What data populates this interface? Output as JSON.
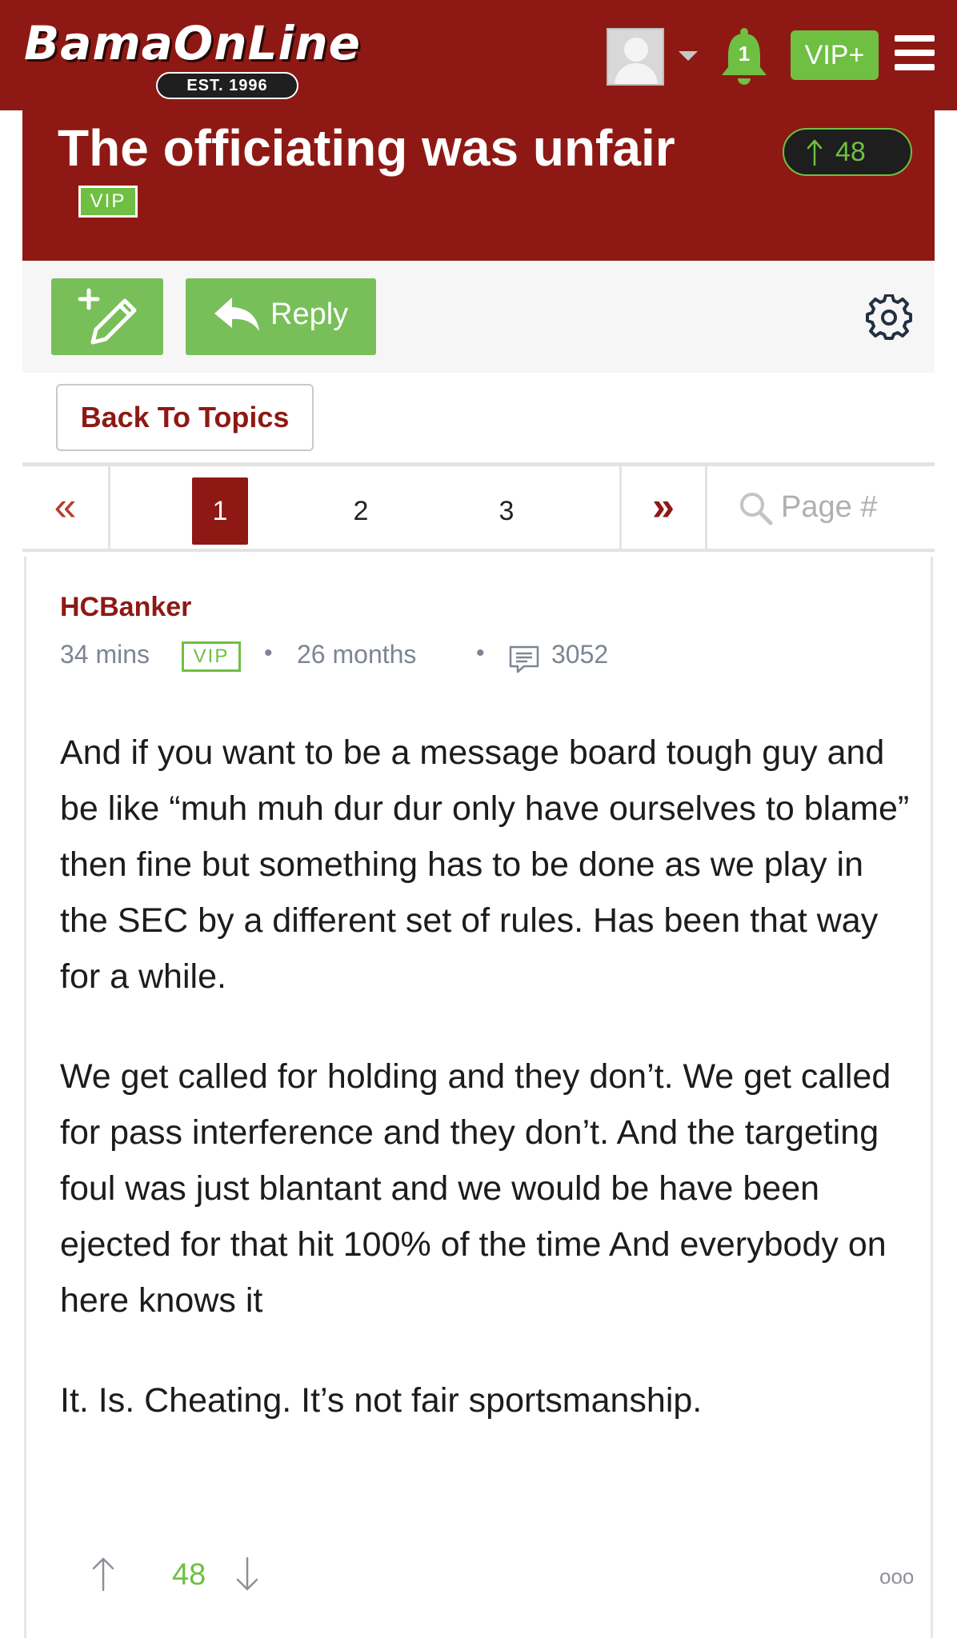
{
  "header": {
    "logo_text": "BamaOnLine",
    "logo_est": "EST. 1996",
    "notification_count": "1",
    "vip_button_label": "VIP+"
  },
  "topic": {
    "title": "The officiating was unfair",
    "badge": "VIP",
    "vote_count": "48"
  },
  "toolbar": {
    "reply_label": "Reply"
  },
  "back_label": "Back To Topics",
  "pagination": {
    "first_glyph": "«",
    "last_glyph": "»",
    "pages": [
      "1",
      "2",
      "3"
    ],
    "current_page": "1",
    "search_placeholder": "Page #"
  },
  "post": {
    "author": "HCBanker",
    "time_ago": "34 mins",
    "badge": "VIP",
    "member_for": "26 months",
    "post_count": "3052",
    "paragraphs": [
      "And if you want to be a message board tough guy and be like “muh muh dur dur only have ourselves to blame” then fine but something has to be done as we play in the SEC by a different set of rules. Has been that way for a while.",
      "We get called for holding and they don’t. We get called for pass interference and they don’t. And the targeting foul was just blantant and we would be have been ejected for that hit 100% of the time And everybody on here knows it",
      "It. Is. Cheating. It’s not fair sportsmanship."
    ],
    "vote_count": "48",
    "more_glyph": "ooo"
  },
  "icons": {
    "avatar": "user-avatar-placeholder",
    "caret": "caret-down-icon",
    "bell": "bell-icon",
    "menu": "hamburger-menu-icon",
    "new_topic": "pencil-plus-icon",
    "reply": "reply-arrow-icon",
    "settings": "gear-icon",
    "search": "search-icon",
    "comments": "comment-icon",
    "upvote": "arrow-up-icon",
    "downvote": "arrow-down-icon"
  },
  "colors": {
    "brand_red": "#8e1914",
    "accent_green": "#6fbf43",
    "button_green": "#78bf5a",
    "meta_gray": "#7d8593"
  }
}
